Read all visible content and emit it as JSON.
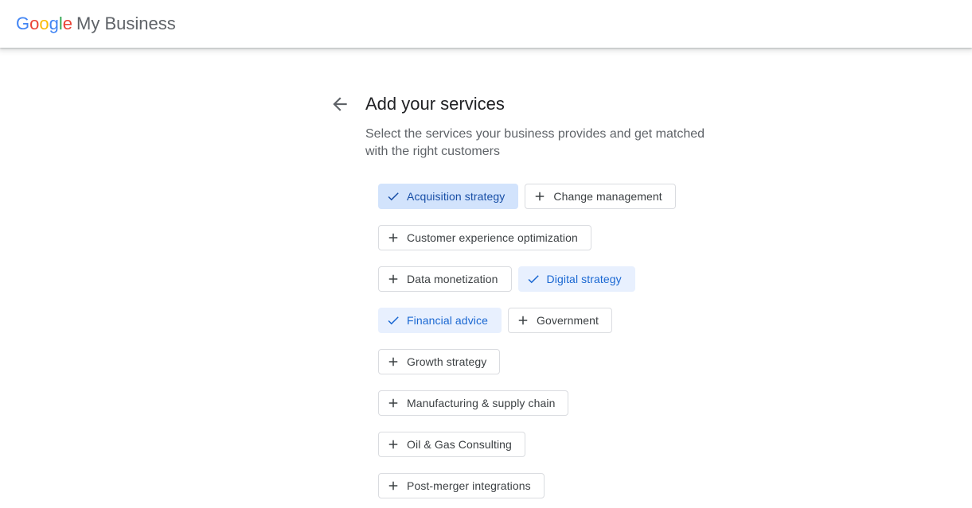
{
  "header": {
    "logo_letters": [
      "G",
      "o",
      "o",
      "g",
      "l",
      "e"
    ],
    "logo_colors": [
      "#4285F4",
      "#EA4335",
      "#FBBC05",
      "#4285F4",
      "#34A853",
      "#EA4335"
    ],
    "product_name": "My Business"
  },
  "page": {
    "back_icon": "arrow-back-icon",
    "title": "Add your services",
    "subtitle": "Select the services your business provides and get matched with the right customers"
  },
  "services": [
    {
      "label": "Acquisition strategy",
      "selected": true,
      "icon": "check-icon"
    },
    {
      "label": "Change management",
      "selected": false,
      "icon": "plus-icon"
    },
    {
      "label": "Customer experience optimization",
      "selected": false,
      "icon": "plus-icon"
    },
    {
      "label": "Data monetization",
      "selected": false,
      "icon": "plus-icon"
    },
    {
      "label": "Digital strategy",
      "selected": true,
      "icon": "check-icon"
    },
    {
      "label": "Financial advice",
      "selected": true,
      "icon": "check-icon"
    },
    {
      "label": "Government",
      "selected": false,
      "icon": "plus-icon"
    },
    {
      "label": "Growth strategy",
      "selected": false,
      "icon": "plus-icon"
    },
    {
      "label": "Manufacturing & supply chain",
      "selected": false,
      "icon": "plus-icon"
    },
    {
      "label": "Oil & Gas Consulting",
      "selected": false,
      "icon": "plus-icon"
    },
    {
      "label": "Post-merger integrations",
      "selected": false,
      "icon": "plus-icon"
    }
  ],
  "colors": {
    "selected_chip_bg": "#e8f0fe",
    "selected_chip_text": "#1967d2",
    "chip_border": "#dadce0",
    "title_text": "#202124",
    "subtitle_text": "#5f6368"
  }
}
